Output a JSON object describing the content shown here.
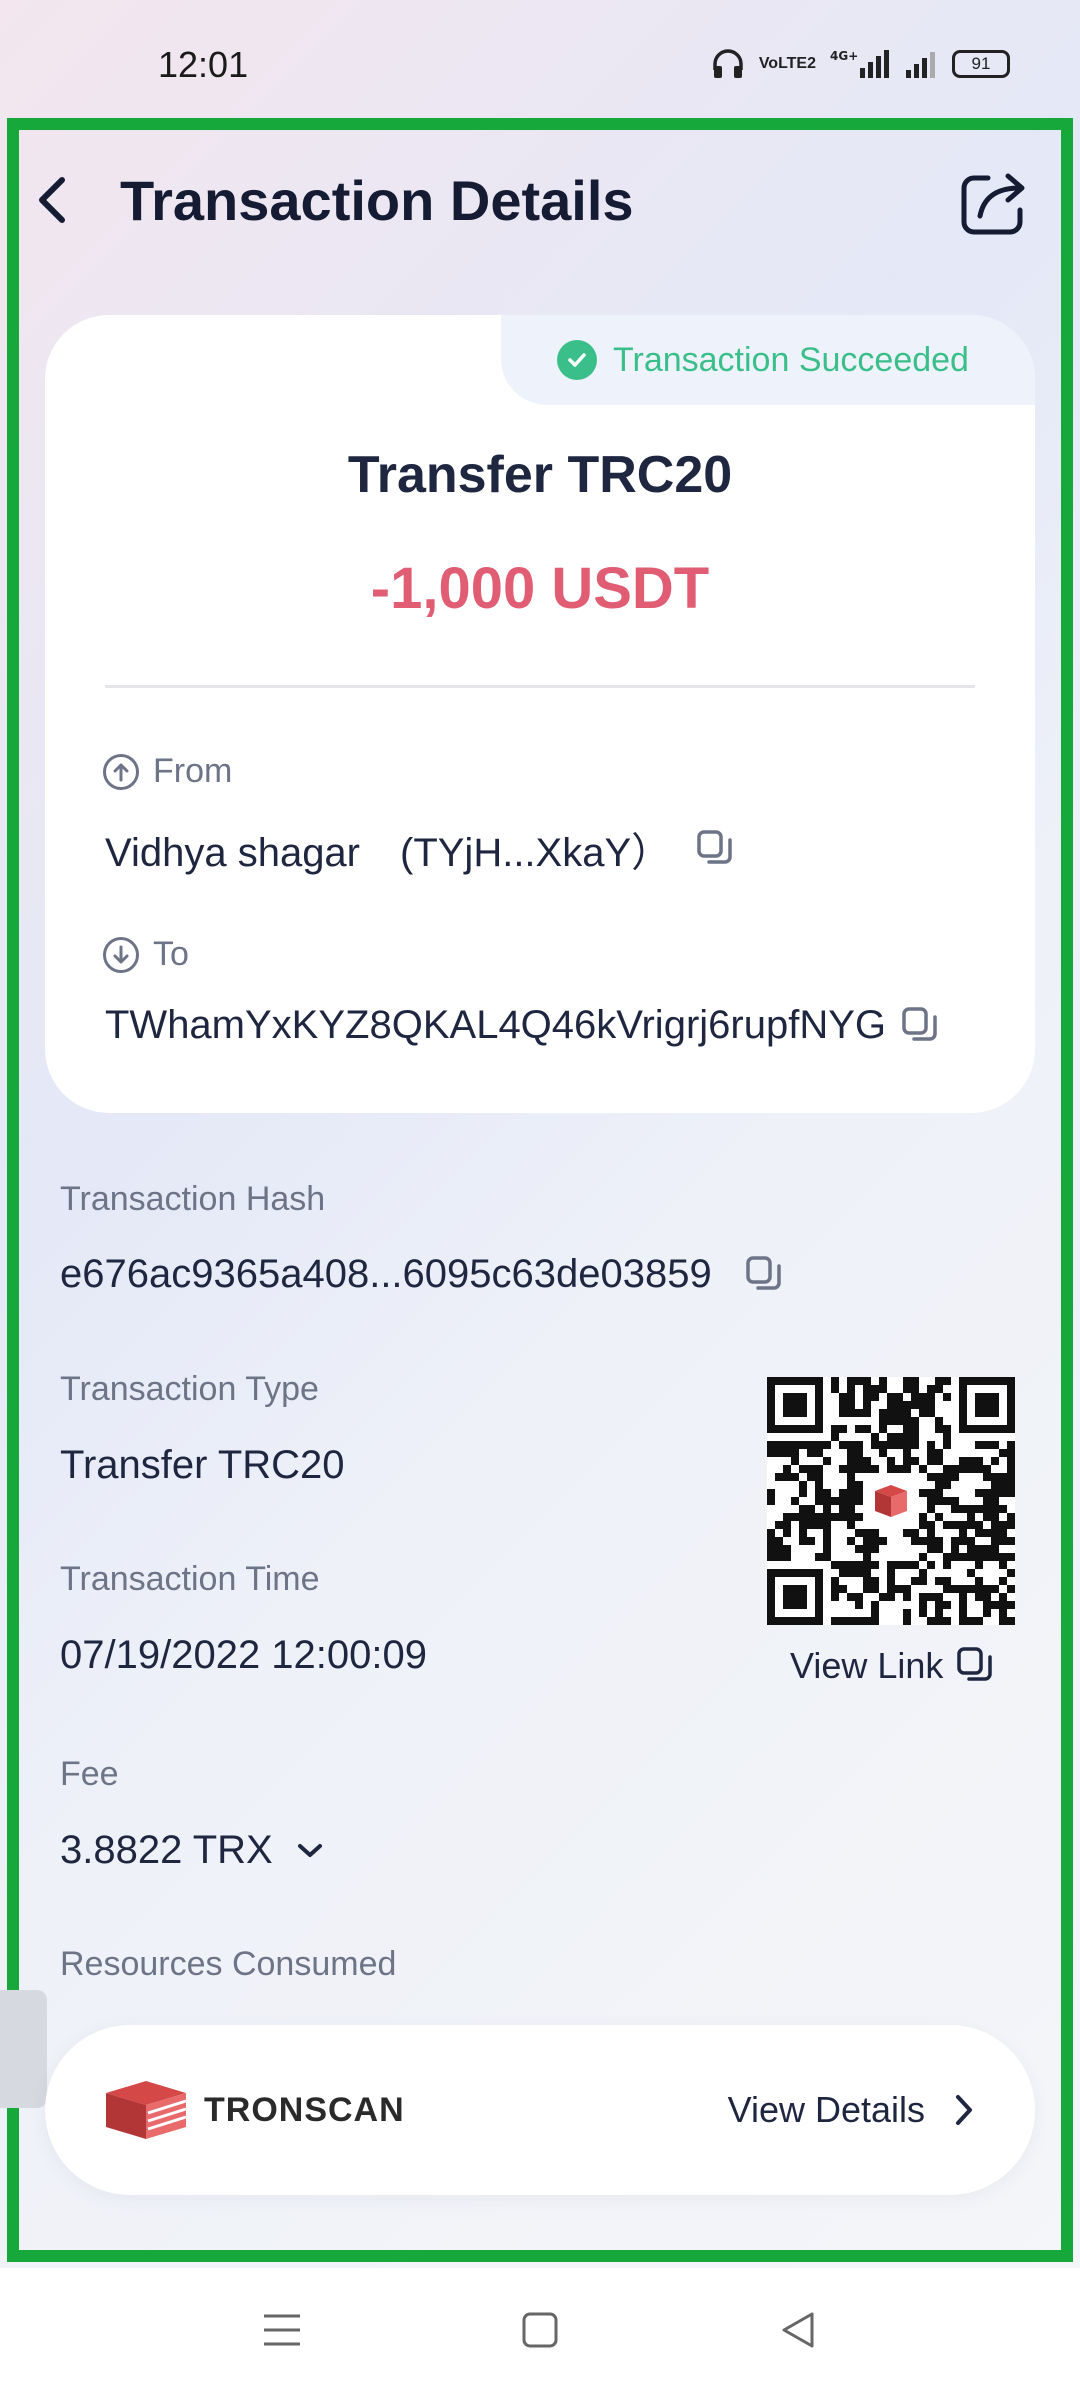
{
  "status_bar": {
    "time": "12:01",
    "network_labels": [
      "VoLTE2",
      "4G+"
    ],
    "battery": "91"
  },
  "header": {
    "title": "Transaction Details",
    "back_icon": "chevron-left-icon",
    "share_icon": "share-external-icon"
  },
  "summary_card": {
    "status": "Transaction Succeeded",
    "status_color": "#3bbf8a",
    "type": "Transfer TRC20",
    "amount": "-1,000 USDT",
    "amount_color": "#e05d73",
    "from_label": "From",
    "from_value": "Vidhya shagar　(TYjH...XkaY）",
    "to_label": "To",
    "to_value": "TWhamYxKYZ8QKAL4Q46kVrigrj6rupfNYG"
  },
  "details": {
    "hash_label": "Transaction Hash",
    "hash_value": "e676ac9365a408...6095c63de03859",
    "type_label": "Transaction Type",
    "type_value": "Transfer TRC20",
    "time_label": "Transaction Time",
    "time_value": "07/19/2022 12:00:09",
    "fee_label": "Fee",
    "fee_value": "3.8822 TRX",
    "resources_label": "Resources Consumed",
    "view_link": "View Link"
  },
  "bottom_bar": {
    "brand": "TRONSCAN",
    "action": "View Details"
  },
  "nav_bar": {
    "icons": [
      "menu-icon",
      "home-square-icon",
      "back-triangle-icon"
    ]
  }
}
